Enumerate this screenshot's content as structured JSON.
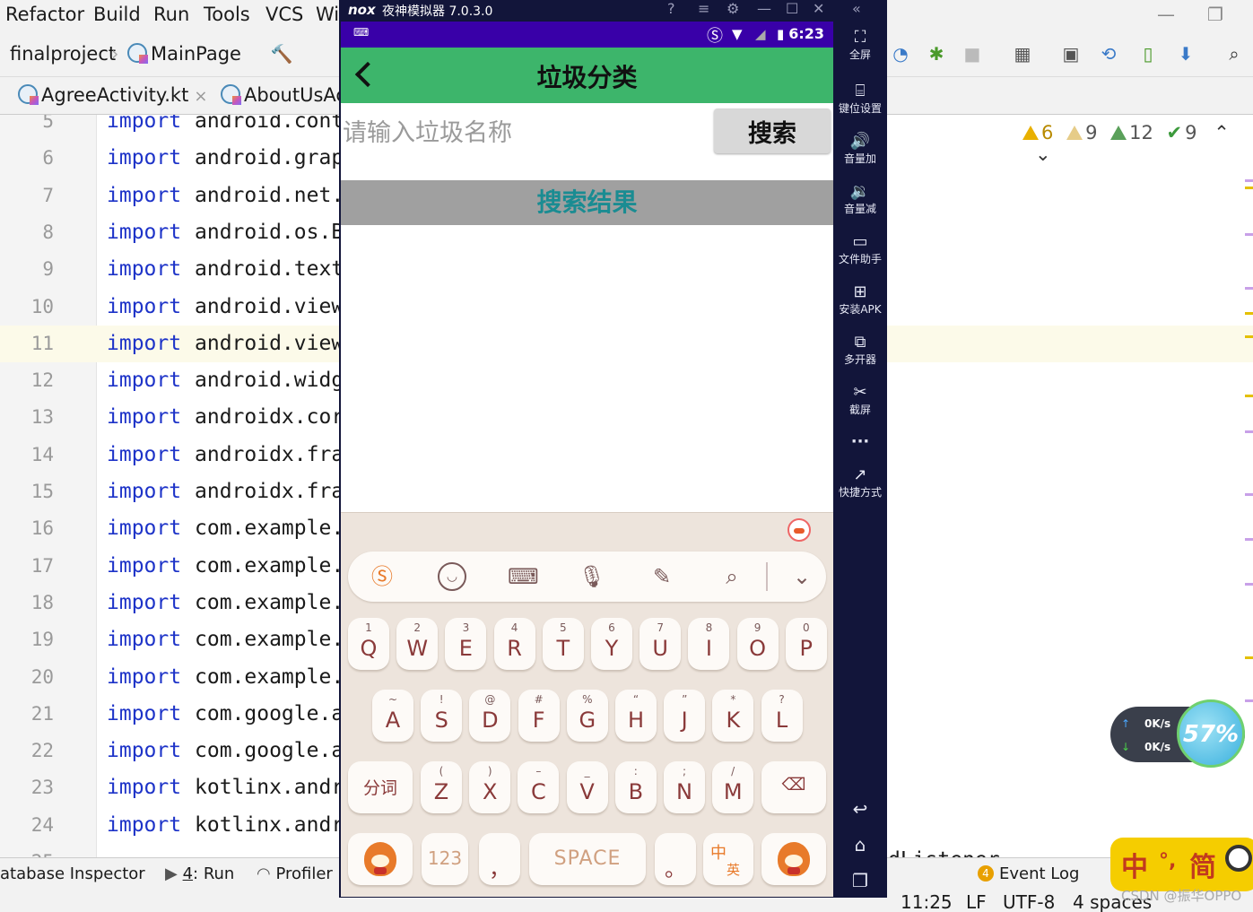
{
  "ide": {
    "menu": [
      "Refactor",
      "Build",
      "Run",
      "Tools",
      "VCS",
      "Wi"
    ],
    "breadcrumb": {
      "project": "finalproject",
      "file": "MainPage"
    },
    "tabs": [
      {
        "label": "AgreeActivity.kt",
        "close": "×"
      },
      {
        "label": "AboutUsAc"
      }
    ],
    "inspections": {
      "warnings": "6",
      "weak_warnings": "9",
      "typos": "12",
      "ok": "9"
    },
    "code_lines": [
      {
        "n": "5",
        "kw": "import",
        "pkg": "android.cont"
      },
      {
        "n": "6",
        "kw": "import",
        "pkg": "android.grap"
      },
      {
        "n": "7",
        "kw": "import",
        "pkg": "android.net."
      },
      {
        "n": "8",
        "kw": "import",
        "pkg": "android.os.B"
      },
      {
        "n": "9",
        "kw": "import",
        "pkg": "android.text"
      },
      {
        "n": "10",
        "kw": "import",
        "pkg": "android.view"
      },
      {
        "n": "11",
        "kw": "import",
        "pkg": "android.view"
      },
      {
        "n": "12",
        "kw": "import",
        "pkg": "android.widg"
      },
      {
        "n": "13",
        "kw": "import",
        "pkg": "androidx.cor"
      },
      {
        "n": "14",
        "kw": "import",
        "pkg": "androidx.fra"
      },
      {
        "n": "15",
        "kw": "import",
        "pkg": "androidx.fra"
      },
      {
        "n": "16",
        "kw": "import",
        "pkg": "com.example."
      },
      {
        "n": "17",
        "kw": "import",
        "pkg": "com.example."
      },
      {
        "n": "18",
        "kw": "import",
        "pkg": "com.example."
      },
      {
        "n": "19",
        "kw": "import",
        "pkg": "com.example."
      },
      {
        "n": "20",
        "kw": "import",
        "pkg": "com.example."
      },
      {
        "n": "21",
        "kw": "import",
        "pkg": "com.google.a"
      },
      {
        "n": "22",
        "kw": "import",
        "pkg": "com.google.a"
      },
      {
        "n": "23",
        "kw": "import",
        "pkg": "kotlinx.andr"
      },
      {
        "n": "24",
        "kw": "import",
        "pkg": "kotlinx.andr"
      },
      {
        "n": "25",
        "kw": "",
        "pkg": ""
      }
    ],
    "right_code": "dListener",
    "bottom_tabs": {
      "db": "atabase Inspector",
      "run_num": "4",
      "run": ": Run",
      "profiler": "Profiler",
      "event_log_count": "4",
      "event_log": "Event Log"
    },
    "status": {
      "pos": "11:25",
      "eol": "LF",
      "enc": "UTF-8",
      "indent": "4 spaces"
    }
  },
  "net_widget": {
    "up": "0K/s",
    "down": "0K/s",
    "percent": "57%"
  },
  "ime_float": {
    "zh": "中",
    "dot": "°,",
    "simp": "简"
  },
  "watermark": "CSDN @振华OPPO",
  "nox": {
    "logo": "nox",
    "title": "夜神模拟器 7.0.3.0",
    "sidebar": [
      {
        "icon": "fullscreen-icon",
        "label": "全屏"
      },
      {
        "icon": "keymap-icon",
        "label": "键位设置"
      },
      {
        "icon": "volume-up-icon",
        "label": "音量加"
      },
      {
        "icon": "volume-down-icon",
        "label": "音量减"
      },
      {
        "icon": "file-helper-icon",
        "label": "文件助手"
      },
      {
        "icon": "install-apk-icon",
        "label": "安装APK"
      },
      {
        "icon": "multi-instance-icon",
        "label": "多开器"
      },
      {
        "icon": "screenshot-icon",
        "label": "截屏"
      },
      {
        "icon": "more-icon",
        "label": "···"
      },
      {
        "icon": "shortcut-icon",
        "label": "快捷方式"
      }
    ]
  },
  "phone": {
    "time": "6:23",
    "title": "垃圾分类",
    "search_placeholder": "请输入垃圾名称",
    "search_value": "",
    "search_button": "搜索",
    "results_header": "搜索结果"
  },
  "keyboard": {
    "row1": [
      {
        "hint": "1",
        "key": "Q"
      },
      {
        "hint": "2",
        "key": "W"
      },
      {
        "hint": "3",
        "key": "E"
      },
      {
        "hint": "4",
        "key": "R"
      },
      {
        "hint": "5",
        "key": "T"
      },
      {
        "hint": "6",
        "key": "Y"
      },
      {
        "hint": "7",
        "key": "U"
      },
      {
        "hint": "8",
        "key": "I"
      },
      {
        "hint": "9",
        "key": "O"
      },
      {
        "hint": "0",
        "key": "P"
      }
    ],
    "row2": [
      {
        "hint": "~",
        "key": "A"
      },
      {
        "hint": "!",
        "key": "S"
      },
      {
        "hint": "@",
        "key": "D"
      },
      {
        "hint": "#",
        "key": "F"
      },
      {
        "hint": "%",
        "key": "G"
      },
      {
        "hint": "“",
        "key": "H"
      },
      {
        "hint": "”",
        "key": "J"
      },
      {
        "hint": "*",
        "key": "K"
      },
      {
        "hint": "?",
        "key": "L"
      }
    ],
    "row3": [
      {
        "hint": "(",
        "key": "Z"
      },
      {
        "hint": ")",
        "key": "X"
      },
      {
        "hint": "–",
        "key": "C"
      },
      {
        "hint": "_",
        "key": "V"
      },
      {
        "hint": ":",
        "key": "B"
      },
      {
        "hint": ";",
        "key": "N"
      },
      {
        "hint": "/",
        "key": "M"
      }
    ],
    "segment_key": "分词",
    "num_key": "123",
    "comma_key": "，",
    "space_key": "SPACE",
    "period_key": "。",
    "lang_key": {
      "zh": "中",
      "en": "英"
    }
  }
}
